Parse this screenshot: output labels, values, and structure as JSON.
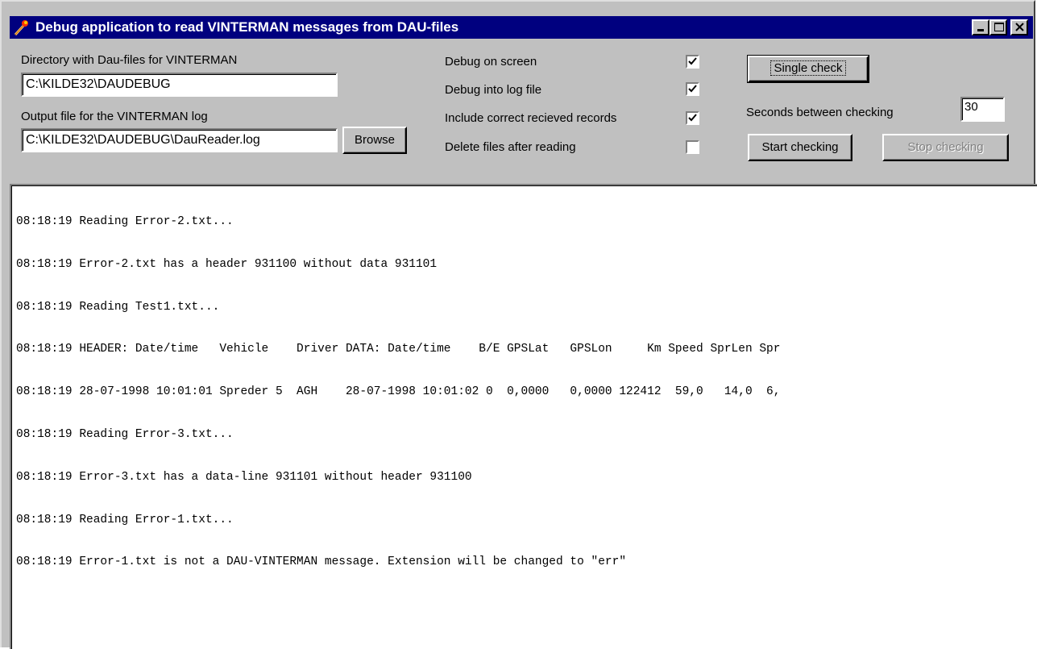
{
  "window": {
    "title": "Debug application to read VINTERMAN messages from DAU-files",
    "icon": "torch-icon",
    "controls": [
      "minimize-icon",
      "maximize-icon",
      "close-icon"
    ]
  },
  "settings": {
    "dir_label": "Directory with Dau-files for VINTERMAN",
    "dir_value": "C:\\KILDE32\\DAUDEBUG",
    "output_label": "Output file for the VINTERMAN log",
    "output_value": "C:\\KILDE32\\DAUDEBUG\\DauReader.log",
    "browse_label": "Browse"
  },
  "options": [
    {
      "label": "Debug on screen",
      "checked": true
    },
    {
      "label": "Debug into log file",
      "checked": true
    },
    {
      "label": "Include correct recieved records",
      "checked": true
    },
    {
      "label": "Delete files after reading",
      "checked": false
    }
  ],
  "controls": {
    "single_check_label": "Single check",
    "seconds_label": "Seconds between checking",
    "seconds_value": "30",
    "start_label": "Start checking",
    "stop_label": "Stop checking",
    "stop_enabled": false
  },
  "log": [
    "08:18:19 Reading Error-2.txt...",
    "08:18:19 Error-2.txt has a header 931100 without data 931101",
    "08:18:19 Reading Test1.txt...",
    "08:18:19 HEADER: Date/time   Vehicle    Driver DATA: Date/time    B/E GPSLat   GPSLon     Km Speed SprLen Spr",
    "08:18:19 28-07-1998 10:01:01 Spreder 5  AGH    28-07-1998 10:01:02 0  0,0000   0,0000 122412  59,0   14,0  6,",
    "08:18:19 Reading Error-3.txt...",
    "08:18:19 Error-3.txt has a data-line 931101 without header 931100",
    "08:18:19 Reading Error-1.txt...",
    "08:18:19 Error-1.txt is not a DAU-VINTERMAN message. Extension will be changed to \"err\""
  ]
}
